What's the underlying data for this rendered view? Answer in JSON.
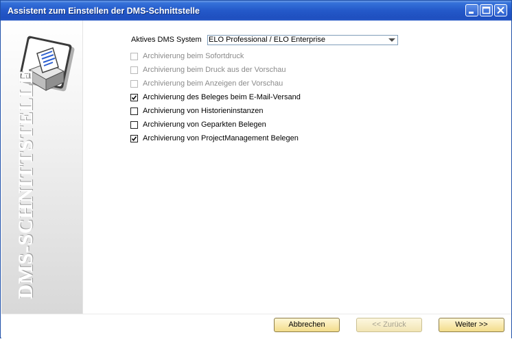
{
  "window": {
    "title": "Assistent zum Einstellen der DMS-Schnittstelle",
    "controls": {
      "minimize": "minimize-icon",
      "maximize": "maximize-icon",
      "close": "close-icon"
    }
  },
  "sidebar": {
    "icon": "printer-document-icon",
    "vertical_text": "DMS-SCHNITTSTELLE"
  },
  "dms": {
    "label": "Aktives DMS System",
    "value": "ELO Professional / ELO Enterprise"
  },
  "options": [
    {
      "label": "Archivierung beim Sofortdruck",
      "checked": false,
      "enabled": false
    },
    {
      "label": "Archivierung beim Druck aus der Vorschau",
      "checked": false,
      "enabled": false
    },
    {
      "label": "Archivierung beim Anzeigen der Vorschau",
      "checked": false,
      "enabled": false
    },
    {
      "label": "Archivierung des Beleges beim E-Mail-Versand",
      "checked": true,
      "enabled": true
    },
    {
      "label": "Archivierung von Historieninstanzen",
      "checked": false,
      "enabled": true
    },
    {
      "label": "Archivierung von Geparkten Belegen",
      "checked": false,
      "enabled": true
    },
    {
      "label": "Archivierung von ProjectManagement Belegen",
      "checked": true,
      "enabled": true
    }
  ],
  "buttons": {
    "cancel": "Abbrechen",
    "back": "<< Zurück",
    "next": "Weiter >>"
  },
  "colors": {
    "titlebar": "#2459c9",
    "button_face": "#f2dc8a",
    "disabled_text": "#8a8a8a"
  }
}
